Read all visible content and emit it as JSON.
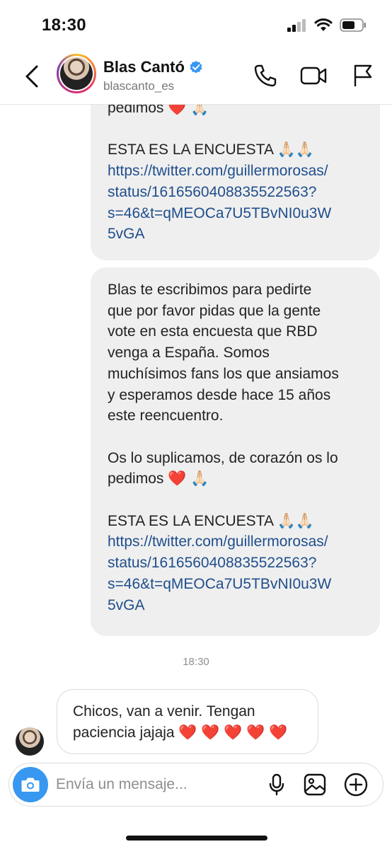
{
  "status_bar": {
    "time": "18:30"
  },
  "header": {
    "contact_name": "Blas Cantó",
    "contact_handle": "blascanto_es",
    "icons": [
      "back-icon",
      "phone-icon",
      "video-icon",
      "flag-icon",
      "verified-icon"
    ]
  },
  "messages": {
    "first_bubble": {
      "line_top": "pedimos ❤️ 🙏🏻",
      "encuesta": "ESTA ES LA ENCUESTA 🙏🏻🙏🏻",
      "link_lines": [
        "https://twitter.com/guillermorosas/",
        "status/1616560408835522563?",
        "s=46&t=qMEOCa7U5TBvNI0u3W",
        "5vGA"
      ]
    },
    "second_bubble": {
      "para1_lines": [
        "Blas te escribimos para pedirte",
        "que por favor pidas que la gente",
        "vote en esta encuesta que RBD",
        "venga a España. Somos",
        "muchísimos fans los que ansiamos",
        "y esperamos desde hace 15 años",
        "este reencuentro."
      ],
      "para2_lines": [
        "Os lo suplicamos, de corazón os lo",
        "pedimos ❤️ 🙏🏻"
      ],
      "encuesta": "ESTA ES LA ENCUESTA 🙏🏻🙏🏻",
      "link_lines": [
        "https://twitter.com/guillermorosas/",
        "status/1616560408835522563?",
        "s=46&t=qMEOCa7U5TBvNI0u3W",
        "5vGA"
      ]
    },
    "timestamp": "18:30",
    "reply": {
      "line1": "Chicos, van a venir. Tengan",
      "line2": "paciencia jajaja ❤️ ❤️ ❤️ ❤️ ❤️"
    }
  },
  "composer": {
    "placeholder": "Envía un mensaje...",
    "icons": [
      "camera-icon",
      "microphone-icon",
      "gallery-icon",
      "plus-icon"
    ]
  },
  "colors": {
    "link": "#1f4e8c",
    "outgoing_bubble": "#efefef",
    "camera_button": "#3897f0",
    "verified": "#3897f0"
  }
}
